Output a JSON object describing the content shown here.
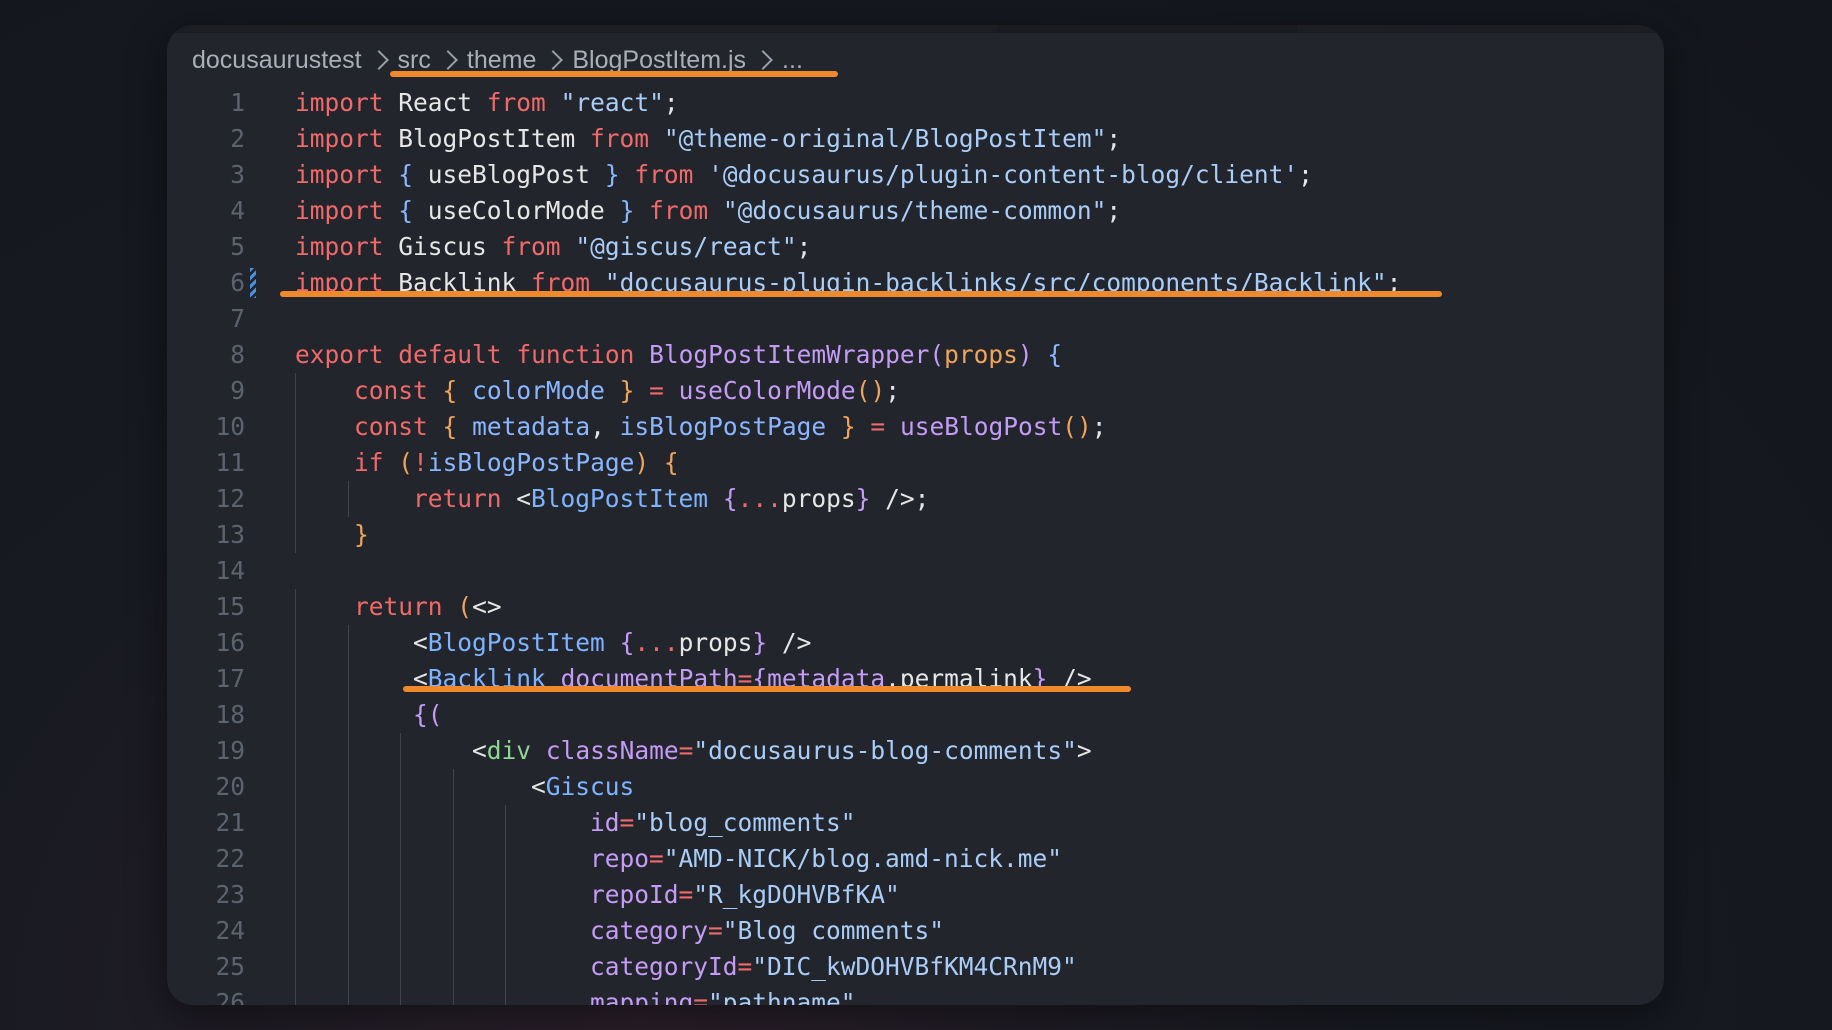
{
  "breadcrumb": {
    "root": "docusaurustest",
    "parts": [
      "src",
      "theme",
      "BlogPostItem.js",
      "..."
    ]
  },
  "accent_color": "#ef8a2c",
  "syntax_colors": {
    "keyword": "#f06a6a",
    "string": "#a9cdf7",
    "function": "#c49bf5",
    "param": "#f0a45a",
    "variable": "#8ab6ff",
    "jsx_tag": "#7eb3ff",
    "html_tag": "#8fd694"
  },
  "gutter_change_line": 6,
  "highlighted_lines": [
    6,
    17
  ],
  "lines": [
    {
      "n": "1",
      "indent": 0,
      "tokens": [
        [
          "kw",
          "import"
        ],
        [
          "pl",
          " React "
        ],
        [
          "kw",
          "from"
        ],
        [
          "pl",
          " "
        ],
        [
          "str",
          "\"react\""
        ],
        [
          "pl",
          ";"
        ]
      ]
    },
    {
      "n": "2",
      "indent": 0,
      "tokens": [
        [
          "kw",
          "import"
        ],
        [
          "pl",
          " BlogPostItem "
        ],
        [
          "kw",
          "from"
        ],
        [
          "pl",
          " "
        ],
        [
          "str",
          "\"@theme-original/BlogPostItem\""
        ],
        [
          "pl",
          ";"
        ]
      ]
    },
    {
      "n": "3",
      "indent": 0,
      "tokens": [
        [
          "kw",
          "import"
        ],
        [
          "pl",
          " "
        ],
        [
          "var",
          "{"
        ],
        [
          "pl",
          " useBlogPost "
        ],
        [
          "var",
          "}"
        ],
        [
          "pl",
          " "
        ],
        [
          "kw",
          "from"
        ],
        [
          "pl",
          " "
        ],
        [
          "str",
          "'@docusaurus/plugin-content-blog/client'"
        ],
        [
          "pl",
          ";"
        ]
      ]
    },
    {
      "n": "4",
      "indent": 0,
      "tokens": [
        [
          "kw",
          "import"
        ],
        [
          "pl",
          " "
        ],
        [
          "var",
          "{"
        ],
        [
          "pl",
          " useColorMode "
        ],
        [
          "var",
          "}"
        ],
        [
          "pl",
          " "
        ],
        [
          "kw",
          "from"
        ],
        [
          "pl",
          " "
        ],
        [
          "str",
          "\"@docusaurus/theme-common\""
        ],
        [
          "pl",
          ";"
        ]
      ]
    },
    {
      "n": "5",
      "indent": 0,
      "tokens": [
        [
          "kw",
          "import"
        ],
        [
          "pl",
          " Giscus "
        ],
        [
          "kw",
          "from"
        ],
        [
          "pl",
          " "
        ],
        [
          "str",
          "\"@giscus/react\""
        ],
        [
          "pl",
          ";"
        ]
      ]
    },
    {
      "n": "6",
      "indent": 0,
      "tokens": [
        [
          "kw",
          "import"
        ],
        [
          "pl",
          " Backlink "
        ],
        [
          "kw",
          "from"
        ],
        [
          "pl",
          " "
        ],
        [
          "str",
          "\"docusaurus-plugin-backlinks/src/components/Backlink\""
        ],
        [
          "pl",
          ";"
        ]
      ]
    },
    {
      "n": "7",
      "indent": 0,
      "tokens": []
    },
    {
      "n": "8",
      "indent": 0,
      "tokens": [
        [
          "kw",
          "export"
        ],
        [
          "pl",
          " "
        ],
        [
          "kw",
          "default"
        ],
        [
          "pl",
          " "
        ],
        [
          "kw",
          "function"
        ],
        [
          "pl",
          " "
        ],
        [
          "fn",
          "BlogPostItemWrapper"
        ],
        [
          "br2",
          "("
        ],
        [
          "pr",
          "props"
        ],
        [
          "br2",
          ")"
        ],
        [
          "pl",
          " "
        ],
        [
          "var",
          "{"
        ]
      ]
    },
    {
      "n": "9",
      "indent": 1,
      "tokens": [
        [
          "kw",
          "const"
        ],
        [
          "pl",
          " "
        ],
        [
          "br1",
          "{"
        ],
        [
          "pl",
          " "
        ],
        [
          "var",
          "colorMode"
        ],
        [
          "pl",
          " "
        ],
        [
          "br1",
          "}"
        ],
        [
          "pl",
          " "
        ],
        [
          "kw",
          "="
        ],
        [
          "pl",
          " "
        ],
        [
          "fn",
          "useColorMode"
        ],
        [
          "br1",
          "()"
        ],
        [
          "pl",
          ";"
        ]
      ]
    },
    {
      "n": "10",
      "indent": 1,
      "tokens": [
        [
          "kw",
          "const"
        ],
        [
          "pl",
          " "
        ],
        [
          "br1",
          "{"
        ],
        [
          "pl",
          " "
        ],
        [
          "var",
          "metadata"
        ],
        [
          "pl",
          ", "
        ],
        [
          "var",
          "isBlogPostPage"
        ],
        [
          "pl",
          " "
        ],
        [
          "br1",
          "}"
        ],
        [
          "pl",
          " "
        ],
        [
          "kw",
          "="
        ],
        [
          "pl",
          " "
        ],
        [
          "fn",
          "useBlogPost"
        ],
        [
          "br1",
          "()"
        ],
        [
          "pl",
          ";"
        ]
      ]
    },
    {
      "n": "11",
      "indent": 1,
      "tokens": [
        [
          "kw",
          "if"
        ],
        [
          "pl",
          " "
        ],
        [
          "br1",
          "("
        ],
        [
          "kw",
          "!"
        ],
        [
          "var",
          "isBlogPostPage"
        ],
        [
          "br1",
          ")"
        ],
        [
          "pl",
          " "
        ],
        [
          "br1",
          "{"
        ]
      ]
    },
    {
      "n": "12",
      "indent": 2,
      "tokens": [
        [
          "kw",
          "return"
        ],
        [
          "pl",
          " <"
        ],
        [
          "tag",
          "BlogPostItem"
        ],
        [
          "pl",
          " "
        ],
        [
          "br2",
          "{"
        ],
        [
          "kw",
          "..."
        ],
        [
          "pl",
          "props"
        ],
        [
          "br2",
          "}"
        ],
        [
          "pl",
          " />;"
        ]
      ]
    },
    {
      "n": "13",
      "indent": 1,
      "tokens": [
        [
          "br1",
          "}"
        ]
      ]
    },
    {
      "n": "14",
      "indent": 0,
      "tokens": []
    },
    {
      "n": "15",
      "indent": 1,
      "tokens": [
        [
          "kw",
          "return"
        ],
        [
          "pl",
          " "
        ],
        [
          "br1",
          "("
        ],
        [
          "pl",
          "<>"
        ]
      ]
    },
    {
      "n": "16",
      "indent": 2,
      "tokens": [
        [
          "pl",
          "<"
        ],
        [
          "tag",
          "BlogPostItem"
        ],
        [
          "pl",
          " "
        ],
        [
          "br2",
          "{"
        ],
        [
          "kw",
          "..."
        ],
        [
          "pl",
          "props"
        ],
        [
          "br2",
          "}"
        ],
        [
          "pl",
          " />"
        ]
      ]
    },
    {
      "n": "17",
      "indent": 2,
      "tokens": [
        [
          "pl",
          "<"
        ],
        [
          "tag",
          "Backlink"
        ],
        [
          "pl",
          " "
        ],
        [
          "attr",
          "documentPath"
        ],
        [
          "kw",
          "="
        ],
        [
          "br2",
          "{"
        ],
        [
          "attr",
          "metadata"
        ],
        [
          "pl",
          ".permalink"
        ],
        [
          "br2",
          "}"
        ],
        [
          "pl",
          " />"
        ]
      ]
    },
    {
      "n": "18",
      "indent": 2,
      "tokens": [
        [
          "br2",
          "{("
        ]
      ]
    },
    {
      "n": "19",
      "indent": 3,
      "tokens": [
        [
          "pl",
          "<"
        ],
        [
          "html",
          "div"
        ],
        [
          "pl",
          " "
        ],
        [
          "attr",
          "className"
        ],
        [
          "kw",
          "="
        ],
        [
          "str",
          "\"docusaurus-blog-comments\""
        ],
        [
          "pl",
          ">"
        ]
      ]
    },
    {
      "n": "20",
      "indent": 4,
      "tokens": [
        [
          "pl",
          "<"
        ],
        [
          "tag",
          "Giscus"
        ]
      ]
    },
    {
      "n": "21",
      "indent": 5,
      "tokens": [
        [
          "attr",
          "id"
        ],
        [
          "kw",
          "="
        ],
        [
          "str",
          "\"blog_comments\""
        ]
      ]
    },
    {
      "n": "22",
      "indent": 5,
      "tokens": [
        [
          "attr",
          "repo"
        ],
        [
          "kw",
          "="
        ],
        [
          "str",
          "\"AMD-NICK/blog.amd-nick.me\""
        ]
      ]
    },
    {
      "n": "23",
      "indent": 5,
      "tokens": [
        [
          "attr",
          "repoId"
        ],
        [
          "kw",
          "="
        ],
        [
          "str",
          "\"R_kgDOHVBfKA\""
        ]
      ]
    },
    {
      "n": "24",
      "indent": 5,
      "tokens": [
        [
          "attr",
          "category"
        ],
        [
          "kw",
          "="
        ],
        [
          "str",
          "\"Blog comments\""
        ]
      ]
    },
    {
      "n": "25",
      "indent": 5,
      "tokens": [
        [
          "attr",
          "categoryId"
        ],
        [
          "kw",
          "="
        ],
        [
          "str",
          "\"DIC_kwDOHVBfKM4CRnM9\""
        ]
      ]
    },
    {
      "n": "26",
      "indent": 5,
      "tokens": [
        [
          "attr",
          "mapping"
        ],
        [
          "kw",
          "="
        ],
        [
          "str",
          "\"pathname\""
        ]
      ]
    }
  ]
}
